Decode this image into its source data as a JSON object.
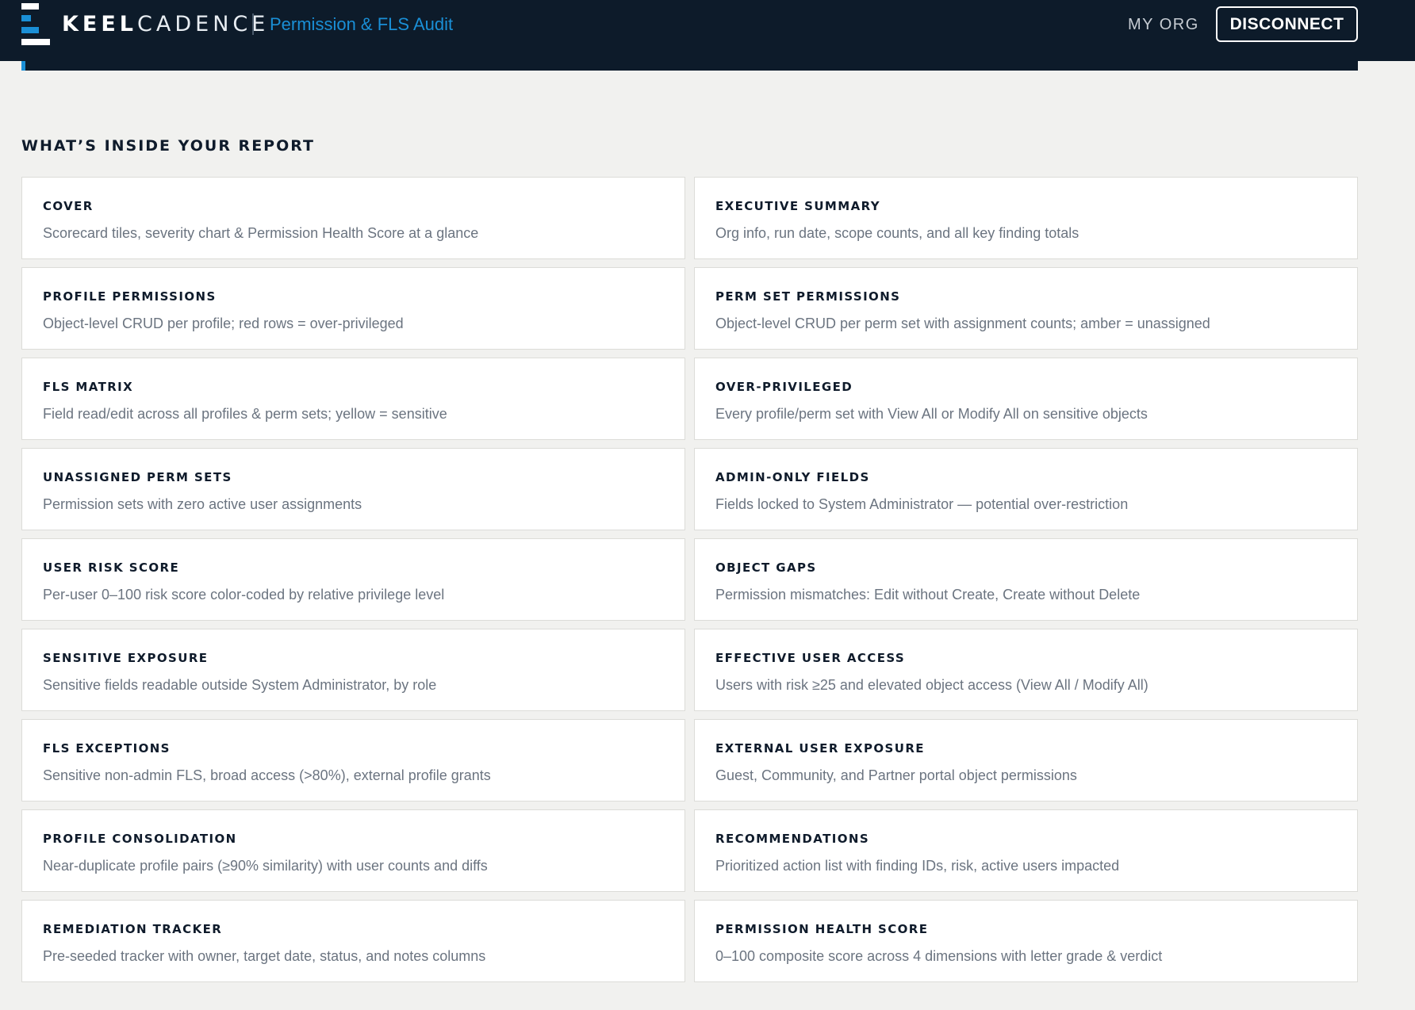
{
  "header": {
    "brand_bold": "KEEL",
    "brand_light": "CADENCE",
    "app_title": "Permission & FLS Audit",
    "my_org_label": "MY ORG",
    "disconnect_label": "DISCONNECT",
    "colors": {
      "background": "#0d1b2a",
      "accent": "#1a8fd6"
    }
  },
  "report": {
    "section_title": "WHAT’S INSIDE YOUR REPORT",
    "cards": [
      {
        "title": "COVER",
        "description": "Scorecard tiles, severity chart & Permission Health Score at a glance"
      },
      {
        "title": "EXECUTIVE SUMMARY",
        "description": "Org info, run date, scope counts, and all key finding totals"
      },
      {
        "title": "PROFILE PERMISSIONS",
        "description": "Object-level CRUD per profile; red rows = over-privileged"
      },
      {
        "title": "PERM SET PERMISSIONS",
        "description": "Object-level CRUD per perm set with assignment counts; amber = unassigned"
      },
      {
        "title": "FLS MATRIX",
        "description": "Field read/edit across all profiles & perm sets; yellow = sensitive"
      },
      {
        "title": "OVER-PRIVILEGED",
        "description": "Every profile/perm set with View All or Modify All on sensitive objects"
      },
      {
        "title": "UNASSIGNED PERM SETS",
        "description": "Permission sets with zero active user assignments"
      },
      {
        "title": "ADMIN-ONLY FIELDS",
        "description": "Fields locked to System Administrator — potential over-restriction"
      },
      {
        "title": "USER RISK SCORE",
        "description": "Per-user 0–100 risk score color-coded by relative privilege level"
      },
      {
        "title": "OBJECT GAPS",
        "description": "Permission mismatches: Edit without Create, Create without Delete"
      },
      {
        "title": "SENSITIVE EXPOSURE",
        "description": "Sensitive fields readable outside System Administrator, by role"
      },
      {
        "title": "EFFECTIVE USER ACCESS",
        "description": "Users with risk ≥25 and elevated object access (View All / Modify All)"
      },
      {
        "title": "FLS EXCEPTIONS",
        "description": "Sensitive non-admin FLS, broad access (>80%), external profile grants"
      },
      {
        "title": "EXTERNAL USER EXPOSURE",
        "description": "Guest, Community, and Partner portal object permissions"
      },
      {
        "title": "PROFILE CONSOLIDATION",
        "description": "Near-duplicate profile pairs (≥90% similarity) with user counts and diffs"
      },
      {
        "title": "RECOMMENDATIONS",
        "description": "Prioritized action list with finding IDs, risk, active users impacted"
      },
      {
        "title": "REMEDIATION TRACKER",
        "description": "Pre-seeded tracker with owner, target date, status, and notes columns"
      },
      {
        "title": "PERMISSION HEALTH SCORE",
        "description": "0–100 composite score across 4 dimensions with letter grade & verdict"
      }
    ]
  }
}
